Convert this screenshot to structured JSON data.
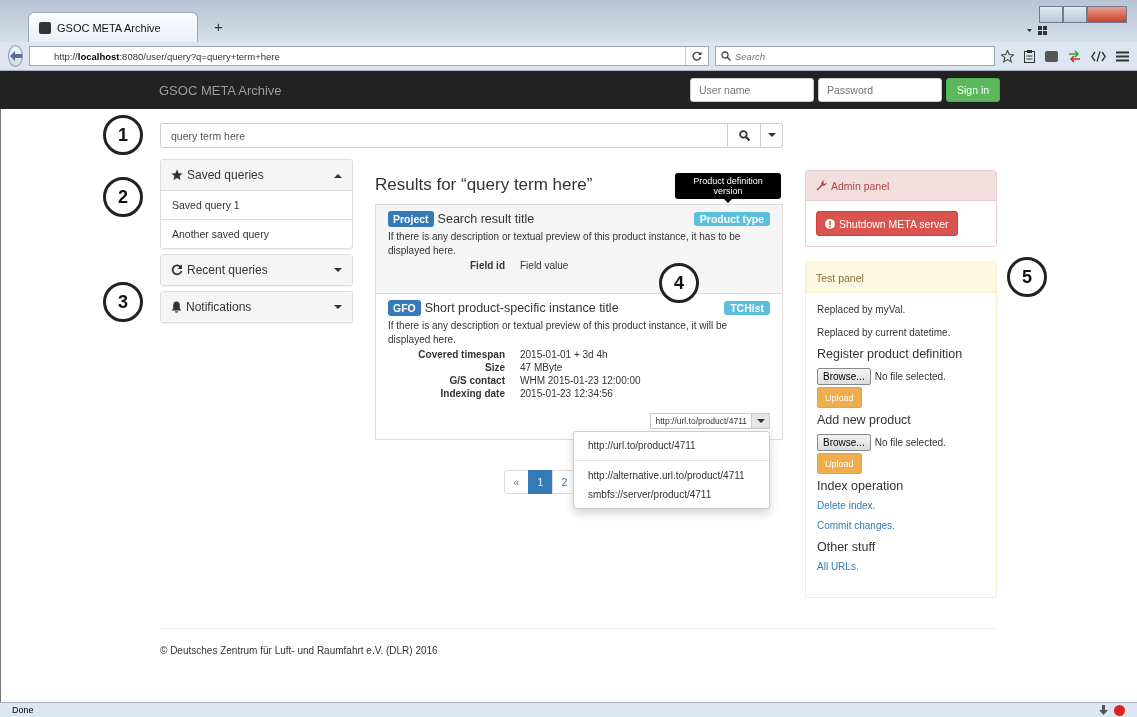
{
  "browser": {
    "tab_title": "GSOC META Archive",
    "new_tab": "+",
    "url": "http://**localhost**:8080/user/query?q=query+term+here",
    "search_placeholder": "Search"
  },
  "navbar": {
    "brand": "GSOC META Archive",
    "username_placeholder": "User name",
    "password_placeholder": "Password",
    "sign_in": "Sign in"
  },
  "callouts": [
    "1",
    "2",
    "3",
    "4",
    "5"
  ],
  "search": {
    "value": "query term here"
  },
  "sidebar": [
    {
      "kind": "star",
      "title": "Saved queries",
      "expanded": true,
      "items": [
        "Saved query 1",
        "Another saved query"
      ]
    },
    {
      "kind": "refresh",
      "title": "Recent queries",
      "expanded": false
    },
    {
      "kind": "bell",
      "title": "Notifications",
      "expanded": false
    }
  ],
  "results": {
    "heading": "Results for “query term here”",
    "items": [
      {
        "badge": "Project",
        "title": "Search result title",
        "tag": "Product type",
        "tooltip": "Product definition version",
        "highlighted": true,
        "description": "If there is any description or textual preview of this product instance, it has to be displayed here.",
        "fields": [
          {
            "label": "Field id",
            "value": "Field value"
          }
        ]
      },
      {
        "badge": "GFO",
        "title": "Short product-specific instance title",
        "tag": "TCHist",
        "highlighted": false,
        "description": "If there is any description or textual preview of this product instance, it will be displayed here.",
        "fields": [
          {
            "label": "Covered timespan",
            "value": "2015-01-01 + 3d 4h"
          },
          {
            "label": "Size",
            "value": "47 MByte"
          },
          {
            "label": "G/S contact",
            "value": "WHM 2015-01-23 12:00:00"
          },
          {
            "label": "Indexing date",
            "value": "2015-01-23 12:34:56"
          }
        ],
        "url": {
          "value": "http://url.to/product/4711",
          "menu_groups": [
            [
              "http://url.to/product/4711"
            ],
            [
              "http://alternative.url.to/product/4711",
              "smbfs://server/product/4711"
            ]
          ]
        }
      }
    ]
  },
  "pagination": [
    {
      "label": "«",
      "selected": false
    },
    {
      "label": "1",
      "selected": true
    },
    {
      "label": "2",
      "selected": false
    }
  ],
  "admin_panel": {
    "title": "Admin panel",
    "button": "Shutdown META server"
  },
  "test_panel": {
    "title": "Test panel",
    "blocks": [
      {
        "kind": "text",
        "text": "Replaced by myVal."
      },
      {
        "kind": "text",
        "text": "Replaced by current datetime."
      },
      {
        "kind": "heading",
        "text": "Register product definition"
      },
      {
        "kind": "file",
        "browse": "Browse...",
        "status": "No file selected.",
        "upload": "Upload"
      },
      {
        "kind": "heading",
        "text": "Add new product"
      },
      {
        "kind": "file",
        "browse": "Browse...",
        "status": "No file selected.",
        "upload": "Upload"
      },
      {
        "kind": "heading",
        "text": "Index operation"
      },
      {
        "kind": "link",
        "text": "Delete index."
      },
      {
        "kind": "link",
        "text": "Commit changes."
      },
      {
        "kind": "heading",
        "text": "Other stuff"
      },
      {
        "kind": "link",
        "text": "All URLs."
      }
    ]
  },
  "footer": "© Deutsches Zentrum für Luft- und Raumfahrt e.V. (DLR) 2016",
  "status_bar": "Done"
}
